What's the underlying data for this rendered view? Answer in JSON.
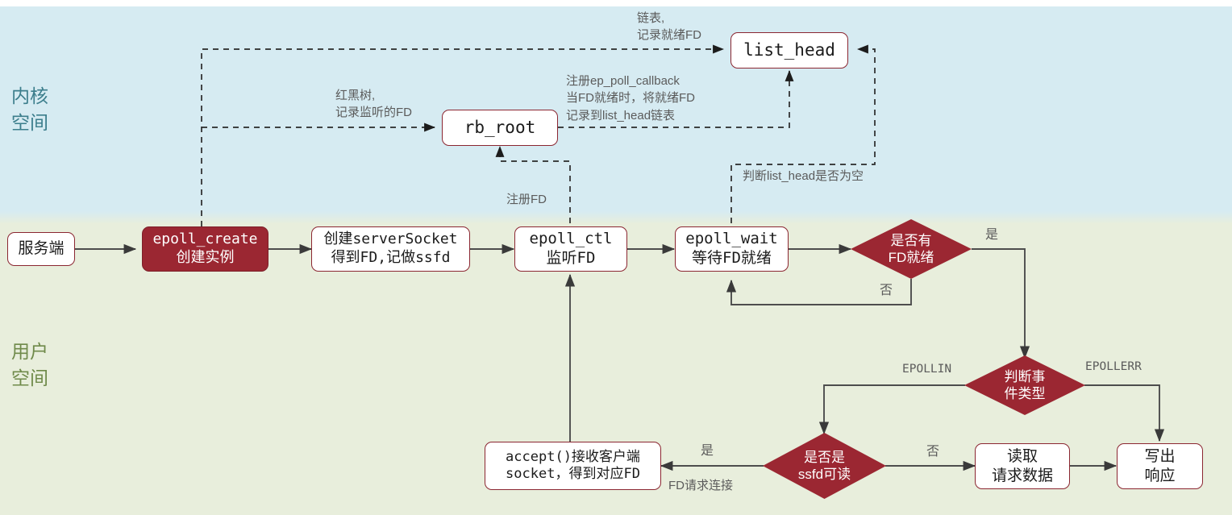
{
  "zones": {
    "kernel": {
      "label": "内核\n空间",
      "color": "#3c7e8c",
      "bg": "#d6ebf2"
    },
    "user": {
      "label": "用户\n空间",
      "color": "#6f8a4a",
      "bg": "#e8eedc"
    }
  },
  "theme": {
    "accent_dark_red": "#9b2732",
    "node_border": "#8b2631",
    "node_fill": "#fdf6f6",
    "edge_color": "#4d4d4d",
    "label_color": "#5b5b5b"
  },
  "nodes": {
    "server": {
      "label": "服务端"
    },
    "epoll_create": {
      "label": "epoll_create\n创建实例"
    },
    "create_socket": {
      "label": "创建serverSocket\n得到FD,记做ssfd"
    },
    "epoll_ctl": {
      "label": "epoll_ctl\n监听FD"
    },
    "epoll_wait": {
      "label": "epoll_wait\n等待FD就绪"
    },
    "rb_root": {
      "label": "rb_root"
    },
    "list_head": {
      "label": "list_head"
    },
    "accept": {
      "label": "accept()接收客户端\nsocket，得到对应FD"
    },
    "read_request": {
      "label": "读取\n请求数据"
    },
    "write_response": {
      "label": "写出\n响应"
    }
  },
  "decisions": {
    "fd_ready": {
      "label": "是否有\nFD就绪"
    },
    "event_type": {
      "label": "判断事\n件类型"
    },
    "ssfd_read": {
      "label": "是否是\nssfd可读"
    }
  },
  "edge_labels": {
    "rbtree": "红黑树,\n记录监听的FD",
    "linkedlist": "链表,\n记录就绪FD",
    "callback": "注册ep_poll_callback\n当FD就绪时，将就绪FD\n记录到list_head链表",
    "register_fd": "注册FD",
    "check_empty": "判断list_head是否为空",
    "ready_yes": "是",
    "ready_no": "否",
    "epollin": "EPOLLIN",
    "epollerr": "EPOLLERR",
    "ssfd_yes": "是",
    "ssfd_yes_sub": "FD请求连接",
    "ssfd_no": "否"
  }
}
